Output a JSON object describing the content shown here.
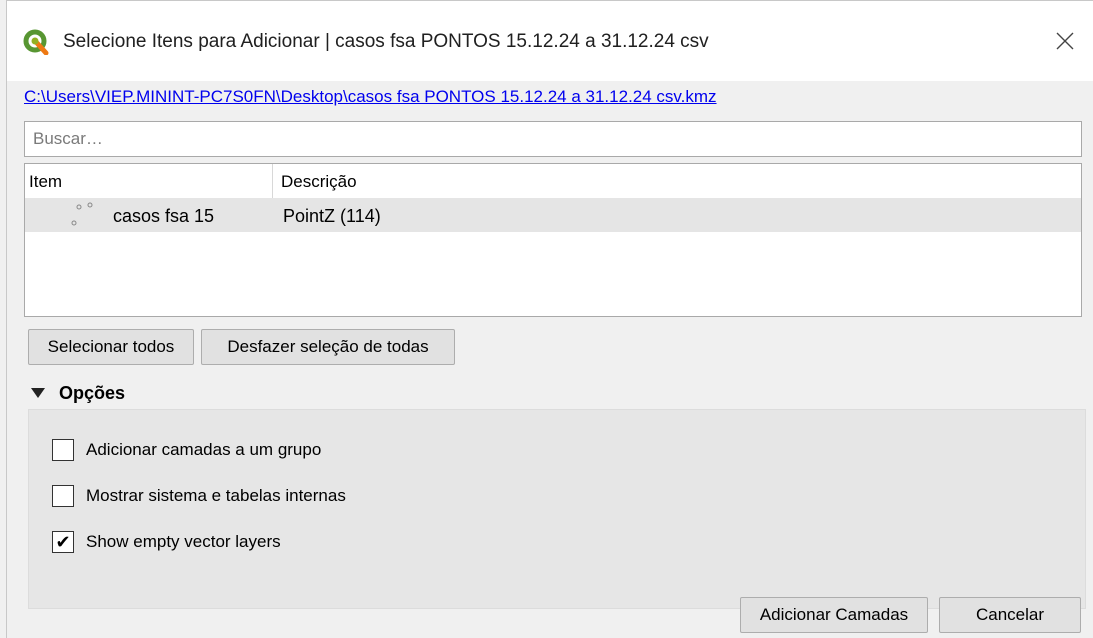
{
  "window": {
    "title": "Selecione Itens para Adicionar | casos fsa  PONTOS 15.12.24 a 31.12.24 csv",
    "app_icon": "qgis-icon",
    "close_icon": "close-icon"
  },
  "file_path": "C:\\Users\\VIEP.MININT-PC7S0FN\\Desktop\\casos fsa PONTOS 15.12.24 a 31.12.24 csv.kmz",
  "search": {
    "placeholder": "Buscar…",
    "value": ""
  },
  "tree": {
    "columns": [
      "Item",
      "Descrição"
    ],
    "rows": [
      {
        "icon": "point-layer-icon",
        "item": "casos fsa 15",
        "description": "PointZ (114)"
      }
    ]
  },
  "buttons": {
    "select_all": "Selecionar todos",
    "deselect_all": "Desfazer seleção de todas",
    "add_layers": "Adicionar Camadas",
    "cancel": "Cancelar"
  },
  "options": {
    "title": "Opções",
    "expanded": true,
    "items": [
      {
        "label": "Adicionar camadas a um grupo",
        "checked": false
      },
      {
        "label": "Mostrar sistema e tabelas internas",
        "checked": false
      },
      {
        "label": "Show empty vector layers",
        "checked": true
      }
    ]
  }
}
